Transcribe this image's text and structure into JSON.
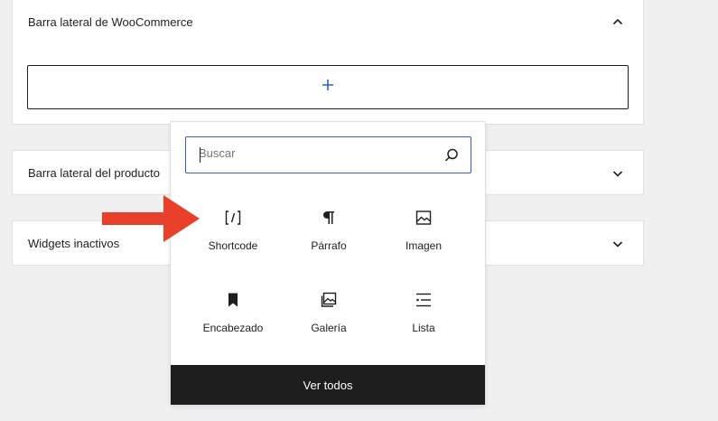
{
  "panels": {
    "woocommerce": {
      "title": "Barra lateral de WooCommerce",
      "chevron_icon": "chevron-up-icon"
    },
    "product": {
      "title": "Barra lateral del producto",
      "chevron_icon": "chevron-down-icon"
    },
    "inactive": {
      "title": "Widgets inactivos",
      "chevron_icon": "chevron-down-icon"
    }
  },
  "add_block": {
    "icon": "plus-icon"
  },
  "annotation": {
    "icon": "arrow-right-icon",
    "color": "#e8402a"
  },
  "inserter": {
    "search": {
      "placeholder": "Buscar",
      "value": "",
      "icon": "search-icon",
      "focus_color": "#3858e9"
    },
    "blocks": [
      {
        "label": "Shortcode",
        "icon": "shortcode-icon"
      },
      {
        "label": "Párrafo",
        "icon": "paragraph-icon"
      },
      {
        "label": "Imagen",
        "icon": "image-icon"
      },
      {
        "label": "Encabezado",
        "icon": "bookmark-icon"
      },
      {
        "label": "Galería",
        "icon": "gallery-icon"
      },
      {
        "label": "Lista",
        "icon": "list-icon"
      }
    ],
    "view_all_label": "Ver todos"
  },
  "colors": {
    "background": "#f0f0f1",
    "panel": "#ffffff",
    "text": "#1e1e1e",
    "footer_button": "#1e1e1e"
  }
}
